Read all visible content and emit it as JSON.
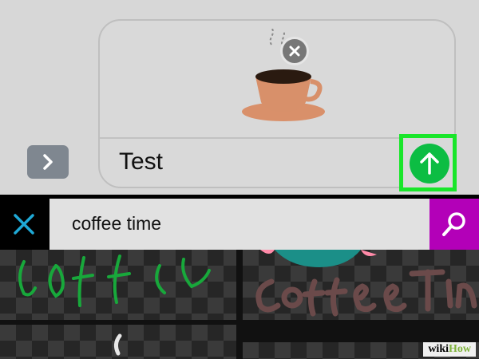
{
  "compose": {
    "message_text": "Test",
    "attachment_icon": "coffee-cup-gif",
    "remove_icon": "close-icon",
    "expand_icon": "chevron-right-icon",
    "send_icon": "arrow-up-icon"
  },
  "search": {
    "query": "coffee time",
    "close_icon": "close-icon",
    "submit_icon": "search-icon"
  },
  "results": [
    {
      "label": "Coffee",
      "icon": "gif-result"
    },
    {
      "label": "Coffee Time",
      "icon": "gif-result"
    },
    {
      "label": "",
      "icon": "gif-result"
    },
    {
      "label": "",
      "icon": "gif-result"
    }
  ],
  "watermark": {
    "part1": "wiki",
    "part2": "How"
  },
  "colors": {
    "send": "#0cbd43",
    "highlight": "#19e62a",
    "search_submit": "#b300b8",
    "close_search": "#1fa9d6"
  }
}
